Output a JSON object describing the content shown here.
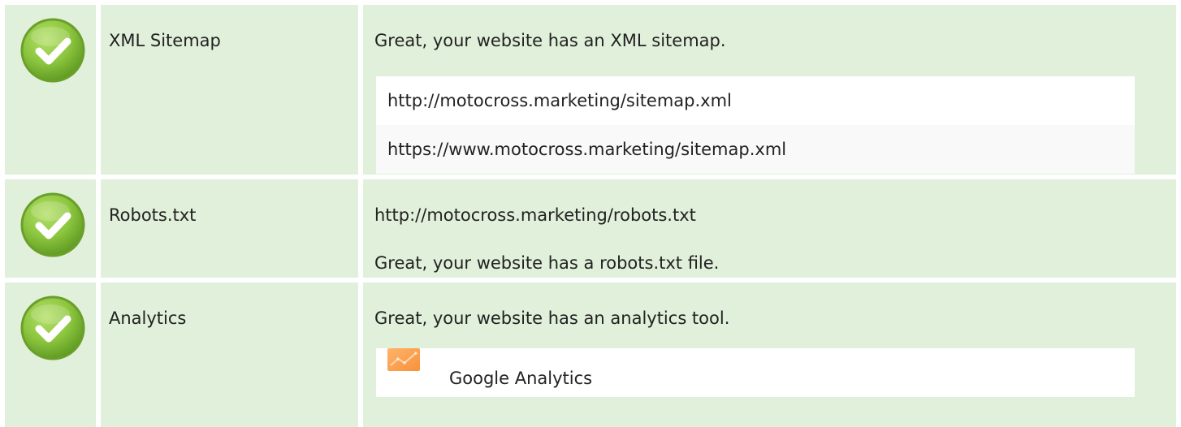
{
  "colors": {
    "row_background": "#e0f0da",
    "box_background": "#ffffff",
    "box_background_alt": "#f9f9f9",
    "pass_icon_green": "#8dc63f",
    "analytics_icon_orange": "#f7923a"
  },
  "checks": [
    {
      "name": "XML Sitemap",
      "status_icon": "check-circle-icon",
      "message": "Great, your website has an XML sitemap.",
      "urls": [
        "http://motocross.marketing/sitemap.xml",
        "https://www.motocross.marketing/sitemap.xml"
      ]
    },
    {
      "name": "Robots.txt",
      "status_icon": "check-circle-icon",
      "url": "http://motocross.marketing/robots.txt",
      "message": "Great, your website has a robots.txt file."
    },
    {
      "name": "Analytics",
      "status_icon": "check-circle-icon",
      "message": "Great, your website has an analytics tool.",
      "tool": {
        "icon": "google-analytics-icon",
        "name": "Google Analytics"
      }
    }
  ]
}
